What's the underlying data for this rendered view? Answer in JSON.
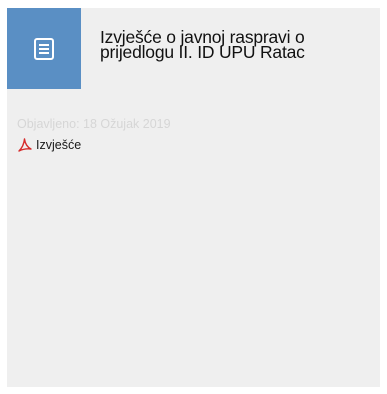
{
  "card": {
    "title_line1": "Izvješće o javnoj raspravi o",
    "title_line2": "prijedlogu II. ID UPU Ratac",
    "published": "Objavljeno: 18 Ožujak 2019",
    "attachments": [
      {
        "label": "Izvješće",
        "icon": "pdf-icon"
      }
    ],
    "header_icon": "document-icon",
    "accent_color": "#5a8fc4",
    "card_background": "#efefef"
  }
}
